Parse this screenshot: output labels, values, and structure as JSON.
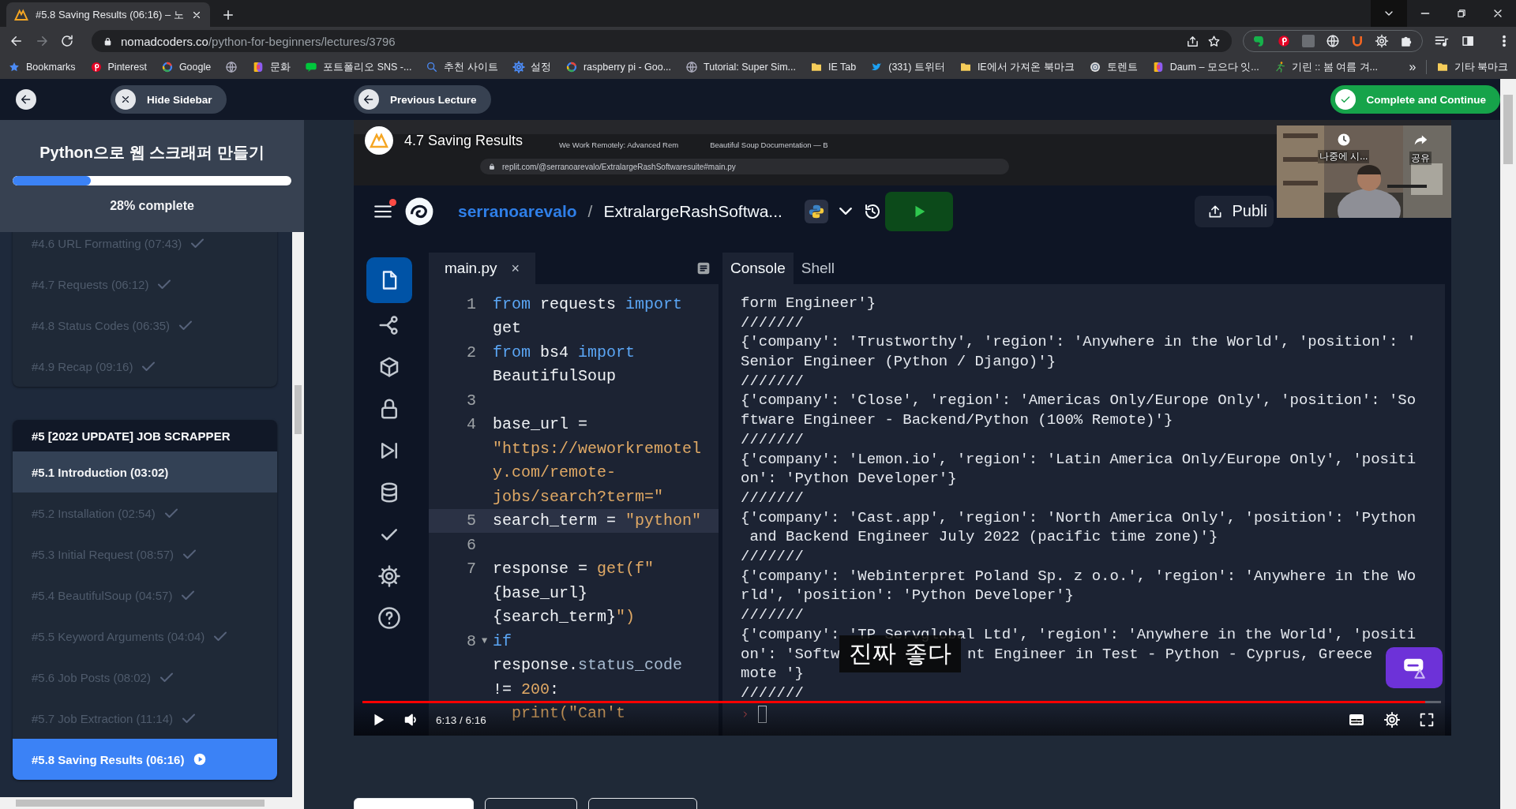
{
  "browser": {
    "tabs": [
      {
        "title": "#5.8 Saving Results (06:16) – 노",
        "selected": true
      }
    ],
    "url": {
      "host": "nomadcoders.co",
      "path": "/python-for-beginners/lectures/3796"
    },
    "bookmarks": [
      {
        "kind": "star",
        "label": "Bookmarks"
      },
      {
        "kind": "pin",
        "label": "Pinterest"
      },
      {
        "kind": "ring",
        "label": "Google"
      },
      {
        "kind": "globe"
      },
      {
        "kind": "square",
        "label": "문화"
      },
      {
        "kind": "chat",
        "label": "포트폴리오 SNS -..."
      },
      {
        "kind": "search",
        "label": "추천 사이트"
      },
      {
        "kind": "gear",
        "label": "설정"
      },
      {
        "kind": "ring",
        "label": "raspberry pi - Goo..."
      },
      {
        "kind": "globe",
        "label": "Tutorial: Super Sim..."
      },
      {
        "kind": "folder",
        "label": "IE Tab"
      },
      {
        "kind": "bird",
        "label": "(331) 트위터"
      },
      {
        "kind": "folder",
        "label": "IE에서 가져온 북마크"
      },
      {
        "kind": "disc",
        "label": "토렌트"
      },
      {
        "kind": "square",
        "label": "Daum – 모으다 잇..."
      },
      {
        "kind": "runner",
        "label": "기린 :: 봄 여름 겨..."
      }
    ],
    "more": "»",
    "other_bookmarks": "기타 북마크"
  },
  "topbar": {
    "hide_sidebar": "Hide Sidebar",
    "previous": "Previous Lecture",
    "complete": "Complete and Continue"
  },
  "sidebar": {
    "course_title": "Python으로 웹 스크래퍼 만들기",
    "level": 0.28,
    "progress_text": "28% complete",
    "lessons_before": [
      {
        "title": "#4.6 URL Formatting (07:43)",
        "completed": true,
        "highlighted": false,
        "selected": false
      },
      {
        "title": "#4.7 Requests (06:12)",
        "completed": true,
        "highlighted": false,
        "selected": false
      },
      {
        "title": "#4.8 Status Codes (06:35)",
        "completed": true,
        "highlighted": false,
        "selected": false
      },
      {
        "title": "#4.9 Recap (09:16)",
        "completed": true,
        "highlighted": false,
        "selected": false
      }
    ],
    "section": {
      "title": "#5 [2022 UPDATE] JOB SCRAPPER",
      "lessons": [
        {
          "title": "#5.1 Introduction (03:02)",
          "completed": false,
          "highlighted": true,
          "selected": false
        },
        {
          "title": "#5.2 Installation (02:54)",
          "completed": true,
          "highlighted": false,
          "selected": false
        },
        {
          "title": "#5.3 Initial Request (08:57)",
          "completed": true,
          "highlighted": false,
          "selected": false
        },
        {
          "title": "#5.4 BeautifulSoup (04:57)",
          "completed": true,
          "highlighted": false,
          "selected": false
        },
        {
          "title": "#5.5 Keyword Arguments (04:04)",
          "completed": true,
          "highlighted": false,
          "selected": false
        },
        {
          "title": "#5.6 Job Posts (08:02)",
          "completed": true,
          "highlighted": false,
          "selected": false
        },
        {
          "title": "#5.7 Job Extraction (11:14)",
          "completed": true,
          "highlighted": false,
          "selected": false
        },
        {
          "title": "#5.8 Saving Results (06:16)",
          "completed": false,
          "highlighted": false,
          "selected": true
        }
      ]
    }
  },
  "video": {
    "title": "4.7 Saving Results",
    "time": "6:13 / 6:16",
    "level": 0.985,
    "subtitle": "진짜 좋다",
    "webcam_labels": [
      "나중에 시...",
      "공유"
    ],
    "recording": {
      "tabs": [
        "We Work Remotely: Advanced Rem",
        "Beautiful Soup Documentation — B"
      ],
      "url": "replit.com/@serranoarevalo/ExtralargeRashSoftwaresuite#main.py",
      "owner": "serranoarevalo",
      "separator": "/",
      "repl": "ExtralargeRashSoftwa...",
      "publish": "Publi",
      "file_tab": "main.py",
      "file_close": "×",
      "code": [
        {
          "number": "1",
          "current": false,
          "spans": [
            {
              "kind": "keyword",
              "text": "from"
            },
            {
              "kind": "plain",
              "text": " requests "
            },
            {
              "kind": "keyword",
              "text": "import"
            }
          ]
        },
        {
          "current": false,
          "spans": [
            {
              "kind": "plain",
              "text": "get"
            }
          ]
        },
        {
          "number": "2",
          "current": false,
          "spans": [
            {
              "kind": "keyword",
              "text": "from"
            },
            {
              "kind": "plain",
              "text": " bs4 "
            },
            {
              "kind": "keyword",
              "text": "import"
            }
          ]
        },
        {
          "current": false,
          "spans": [
            {
              "kind": "plain",
              "text": "BeautifulSoup"
            }
          ]
        },
        {
          "number": "3",
          "current": false
        },
        {
          "number": "4",
          "current": false,
          "spans": [
            {
              "kind": "plain",
              "text": "base_url ="
            }
          ]
        },
        {
          "current": false,
          "spans": [
            {
              "kind": "string",
              "text": "\"https://weworkremotel"
            }
          ]
        },
        {
          "current": false,
          "spans": [
            {
              "kind": "string",
              "text": "y.com/remote-"
            }
          ]
        },
        {
          "current": false,
          "spans": [
            {
              "kind": "string",
              "text": "jobs/search?term=\""
            }
          ]
        },
        {
          "number": "5",
          "current": true,
          "spans": [
            {
              "kind": "plain",
              "text": "search_term = "
            },
            {
              "kind": "string",
              "text": "\"python\""
            }
          ]
        },
        {
          "number": "6",
          "current": false
        },
        {
          "number": "7",
          "current": false,
          "spans": [
            {
              "kind": "plain",
              "text": "response = "
            },
            {
              "kind": "string",
              "text": "get(f\""
            }
          ]
        },
        {
          "current": false,
          "spans": [
            {
              "kind": "plain",
              "text": "{base_url}"
            }
          ]
        },
        {
          "current": false,
          "spans": [
            {
              "kind": "plain",
              "text": "{search_term}"
            },
            {
              "kind": "string",
              "text": "\")"
            }
          ]
        },
        {
          "number": "8",
          "fold": "▼",
          "current": false,
          "spans": [
            {
              "kind": "keyword",
              "text": "if"
            }
          ]
        },
        {
          "current": false,
          "spans": [
            {
              "kind": "plain",
              "text": "response."
            },
            {
              "kind": "attr",
              "text": "status_code"
            }
          ]
        },
        {
          "current": false,
          "spans": [
            {
              "kind": "plain",
              "text": "!= "
            },
            {
              "kind": "string",
              "text": "200"
            },
            {
              "kind": "plain",
              "text": ":"
            }
          ]
        },
        {
          "current": false,
          "spans": [
            {
              "kind": "string",
              "text": "  print(\"Can't"
            }
          ]
        }
      ],
      "console_tabs": [
        {
          "label": "Console",
          "selected": true
        },
        {
          "label": "Shell",
          "selected": false
        }
      ],
      "console": [
        {
          "kind": "text",
          "text": "form Engineer'}"
        },
        {
          "kind": "text",
          "text": "///////"
        },
        {
          "kind": "text",
          "text": "{'company': 'Trustworthy', 'region': 'Anywhere in the World', 'position': '"
        },
        {
          "kind": "text",
          "text": "Senior Engineer (Python / Django)'}"
        },
        {
          "kind": "text",
          "text": "///////"
        },
        {
          "kind": "text",
          "text": "{'company': 'Close', 'region': 'Americas Only/Europe Only', 'position': 'So"
        },
        {
          "kind": "text",
          "text": "ftware Engineer - Backend/Python (100% Remote)'}"
        },
        {
          "kind": "text",
          "text": "///////"
        },
        {
          "kind": "text",
          "text": "{'company': 'Lemon.io', 'region': 'Latin America Only/Europe Only', 'positi"
        },
        {
          "kind": "text",
          "text": "on': 'Python Developer'}"
        },
        {
          "kind": "text",
          "text": "///////"
        },
        {
          "kind": "text",
          "text": "{'company': 'Cast.app', 'region': 'North America Only', 'position': 'Python"
        },
        {
          "kind": "text",
          "text": " and Backend Engineer July 2022 (pacific time zone)'}"
        },
        {
          "kind": "text",
          "text": "///////"
        },
        {
          "kind": "text",
          "text": "{'company': 'Webinterpret Poland Sp. z o.o.', 'region': 'Anywhere in the Wo"
        },
        {
          "kind": "text",
          "text": "rld', 'position': 'Python Developer'}"
        },
        {
          "kind": "text",
          "text": "///////"
        },
        {
          "kind": "text",
          "text": "{'company': 'TP Servglobal Ltd', 'region': 'Anywhere in the World', 'positi"
        },
        {
          "kind": "subtitled",
          "parts": [
            "on': 'Softw",
            "nt Engineer in Test - Python - Cyprus, Greece"
          ]
        },
        {
          "kind": "text",
          "text": "mote '}"
        },
        {
          "kind": "text",
          "text": "///////"
        }
      ]
    }
  }
}
